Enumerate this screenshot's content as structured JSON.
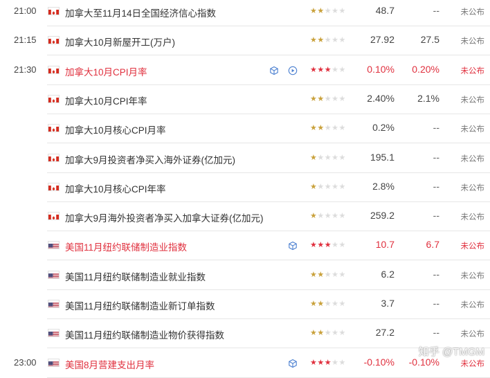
{
  "watermark": "知乎 @TMGM",
  "colors": {
    "hot": "#e0303e",
    "star_normal": "#c9a13b",
    "star_off": "#dcdcdc"
  },
  "rows": [
    {
      "time": "21:00",
      "country": "CA",
      "title": "加拿大至11月14日全国经济信心指数",
      "stars": 2,
      "prev": "48.7",
      "forecast": "--",
      "status": "未公布",
      "hot": false,
      "icons": []
    },
    {
      "time": "21:15",
      "country": "CA",
      "title": "加拿大10月新屋开工(万户)",
      "stars": 2,
      "prev": "27.92",
      "forecast": "27.5",
      "status": "未公布",
      "hot": false,
      "icons": []
    },
    {
      "time": "21:30",
      "country": "CA",
      "title": "加拿大10月CPI月率",
      "stars": 3,
      "prev": "0.10%",
      "forecast": "0.20%",
      "status": "未公布",
      "hot": true,
      "icons": [
        "cube-icon",
        "play-icon"
      ]
    },
    {
      "time": "",
      "country": "CA",
      "title": "加拿大10月CPI年率",
      "stars": 2,
      "prev": "2.40%",
      "forecast": "2.1%",
      "status": "未公布",
      "hot": false,
      "icons": []
    },
    {
      "time": "",
      "country": "CA",
      "title": "加拿大10月核心CPI月率",
      "stars": 2,
      "prev": "0.2%",
      "forecast": "--",
      "status": "未公布",
      "hot": false,
      "icons": []
    },
    {
      "time": "",
      "country": "CA",
      "title": "加拿大9月投资者净买入海外证券(亿加元)",
      "stars": 1,
      "prev": "195.1",
      "forecast": "--",
      "status": "未公布",
      "hot": false,
      "icons": []
    },
    {
      "time": "",
      "country": "CA",
      "title": "加拿大10月核心CPI年率",
      "stars": 1,
      "prev": "2.8%",
      "forecast": "--",
      "status": "未公布",
      "hot": false,
      "icons": []
    },
    {
      "time": "",
      "country": "CA",
      "title": "加拿大9月海外投资者净买入加拿大证券(亿加元)",
      "stars": 1,
      "prev": "259.2",
      "forecast": "--",
      "status": "未公布",
      "hot": false,
      "icons": []
    },
    {
      "time": "",
      "country": "US",
      "title": "美国11月纽约联储制造业指数",
      "stars": 3,
      "prev": "10.7",
      "forecast": "6.7",
      "status": "未公布",
      "hot": true,
      "icons": [
        "cube-icon"
      ]
    },
    {
      "time": "",
      "country": "US",
      "title": "美国11月纽约联储制造业就业指数",
      "stars": 2,
      "prev": "6.2",
      "forecast": "--",
      "status": "未公布",
      "hot": false,
      "icons": []
    },
    {
      "time": "",
      "country": "US",
      "title": "美国11月纽约联储制造业新订单指数",
      "stars": 2,
      "prev": "3.7",
      "forecast": "--",
      "status": "未公布",
      "hot": false,
      "icons": []
    },
    {
      "time": "",
      "country": "US",
      "title": "美国11月纽约联储制造业物价获得指数",
      "stars": 2,
      "prev": "27.2",
      "forecast": "--",
      "status": "未公布",
      "hot": false,
      "icons": []
    },
    {
      "time": "23:00",
      "country": "US",
      "title": "美国8月营建支出月率",
      "stars": 3,
      "prev": "-0.10%",
      "forecast": "-0.10%",
      "status": "未公布",
      "hot": true,
      "icons": [
        "cube-icon"
      ]
    }
  ]
}
